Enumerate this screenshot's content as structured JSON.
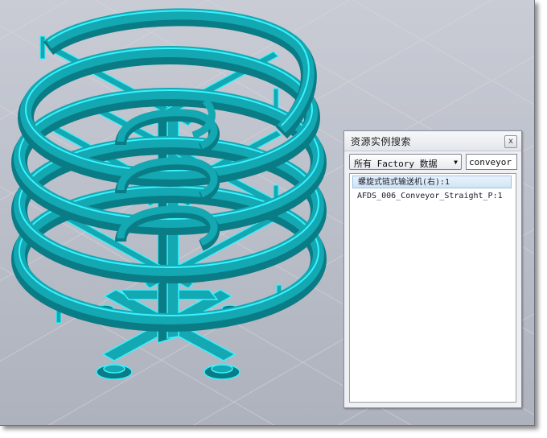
{
  "panel": {
    "title": "资源实例搜索",
    "close_glyph": "x",
    "filter_select": {
      "selected": "所有 Factory 数据",
      "arrow_glyph": "▼"
    },
    "search": {
      "value": "conveyor"
    },
    "results": [
      {
        "label": "螺旋式链式输送机(右):1",
        "selected": true
      },
      {
        "label": "AFDS_006_Conveyor_Straight_P:1",
        "selected": false
      }
    ]
  },
  "viewport": {
    "model": "spiral-conveyor",
    "colors": {
      "model_fill": "#13a8b2",
      "model_edge": "#38f2ff",
      "model_dark": "#0a7c86",
      "background_top": "#c9ccd5",
      "background_bottom": "#aeb2bd",
      "grid_line": "#d7dae2"
    }
  }
}
